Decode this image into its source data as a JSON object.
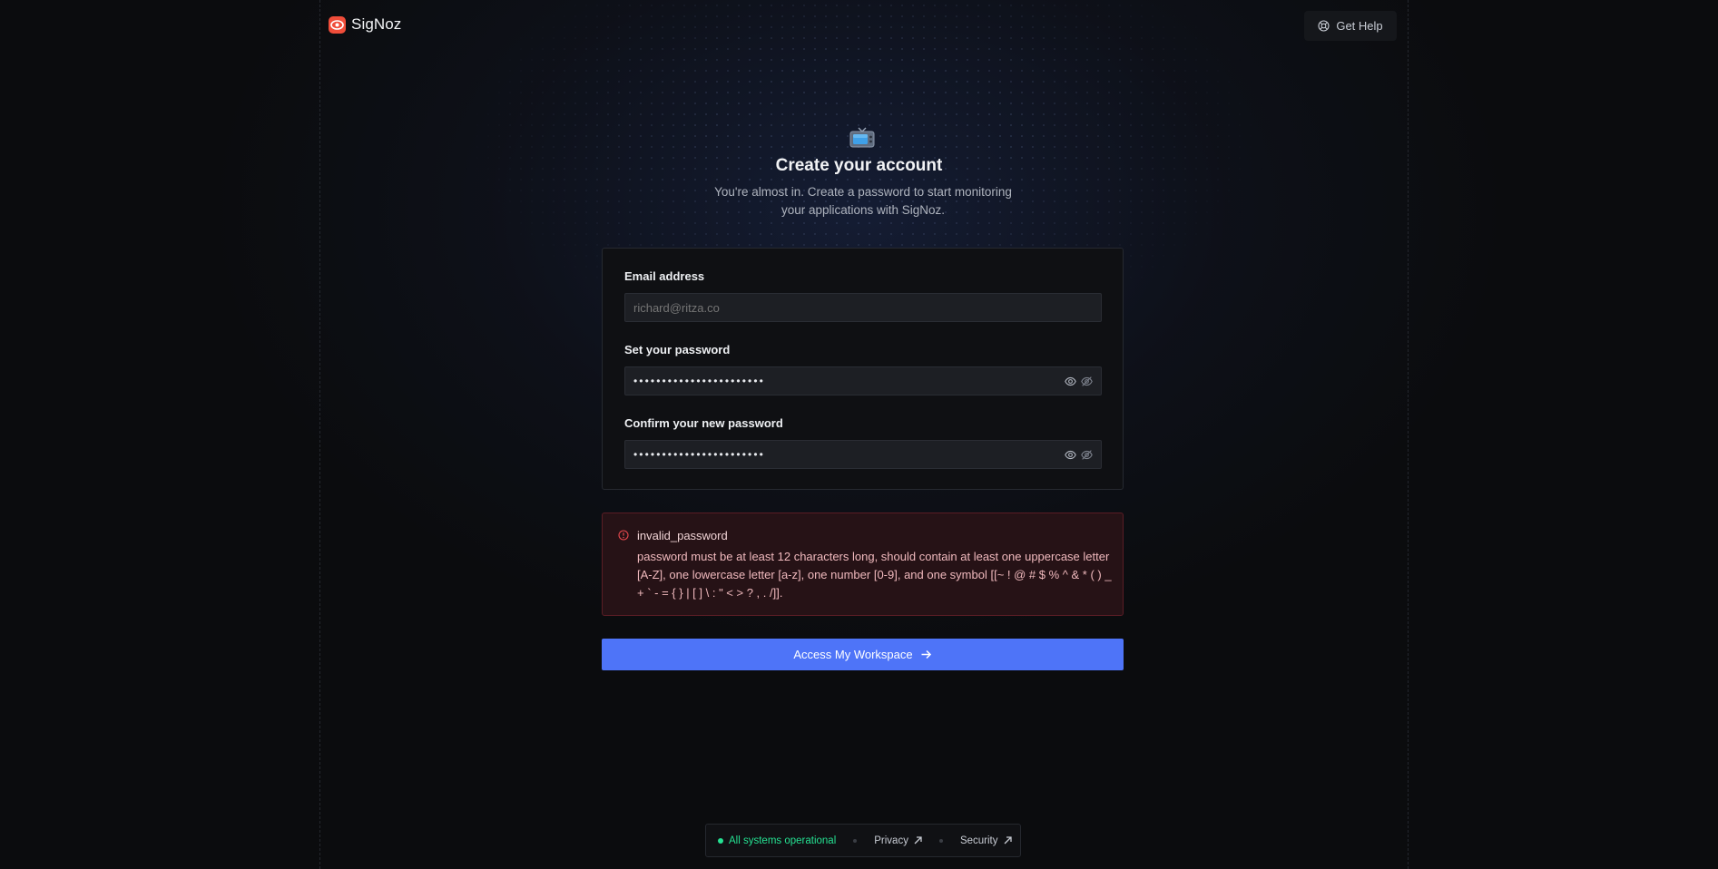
{
  "header": {
    "brand_name": "SigNoz",
    "help_label": "Get Help"
  },
  "heading": {
    "title": "Create your account",
    "subtitle": "You're almost in. Create a password to start monitoring your applications with SigNoz."
  },
  "form": {
    "email_label": "Email address",
    "email_placeholder": "richard@ritza.co",
    "password_label": "Set your password",
    "password_masked": "•••••••••••••••••••••••",
    "confirm_label": "Confirm your new password",
    "confirm_masked": "•••••••••••••••••••••••"
  },
  "alert": {
    "title": "invalid_password",
    "message": "password must be at least 12 characters long, should contain at least one uppercase letter [A-Z], one lowercase letter [a-z], one number [0-9], and one symbol [[~ ! @ # $ % ^ & * ( ) _ + ` - = { } | [ ] \\ : \" < > ? , . /]]."
  },
  "submit": {
    "label": "Access My Workspace"
  },
  "footer": {
    "status": "All systems operational",
    "privacy": "Privacy",
    "security": "Security"
  },
  "colors": {
    "brand": "#f04d3a",
    "primary": "#4e74f8",
    "status_ok": "#25e192",
    "error_bg": "#261216",
    "error_border": "#5a1d25"
  },
  "icons": {
    "brand": "signoz-logo-icon",
    "help": "help-circle-icon",
    "heading": "television-icon",
    "show_password": "eye-icon",
    "hide_password": "eye-off-icon",
    "alert": "alert-circle-icon",
    "submit": "arrow-right-icon",
    "external": "arrow-up-right-icon"
  }
}
